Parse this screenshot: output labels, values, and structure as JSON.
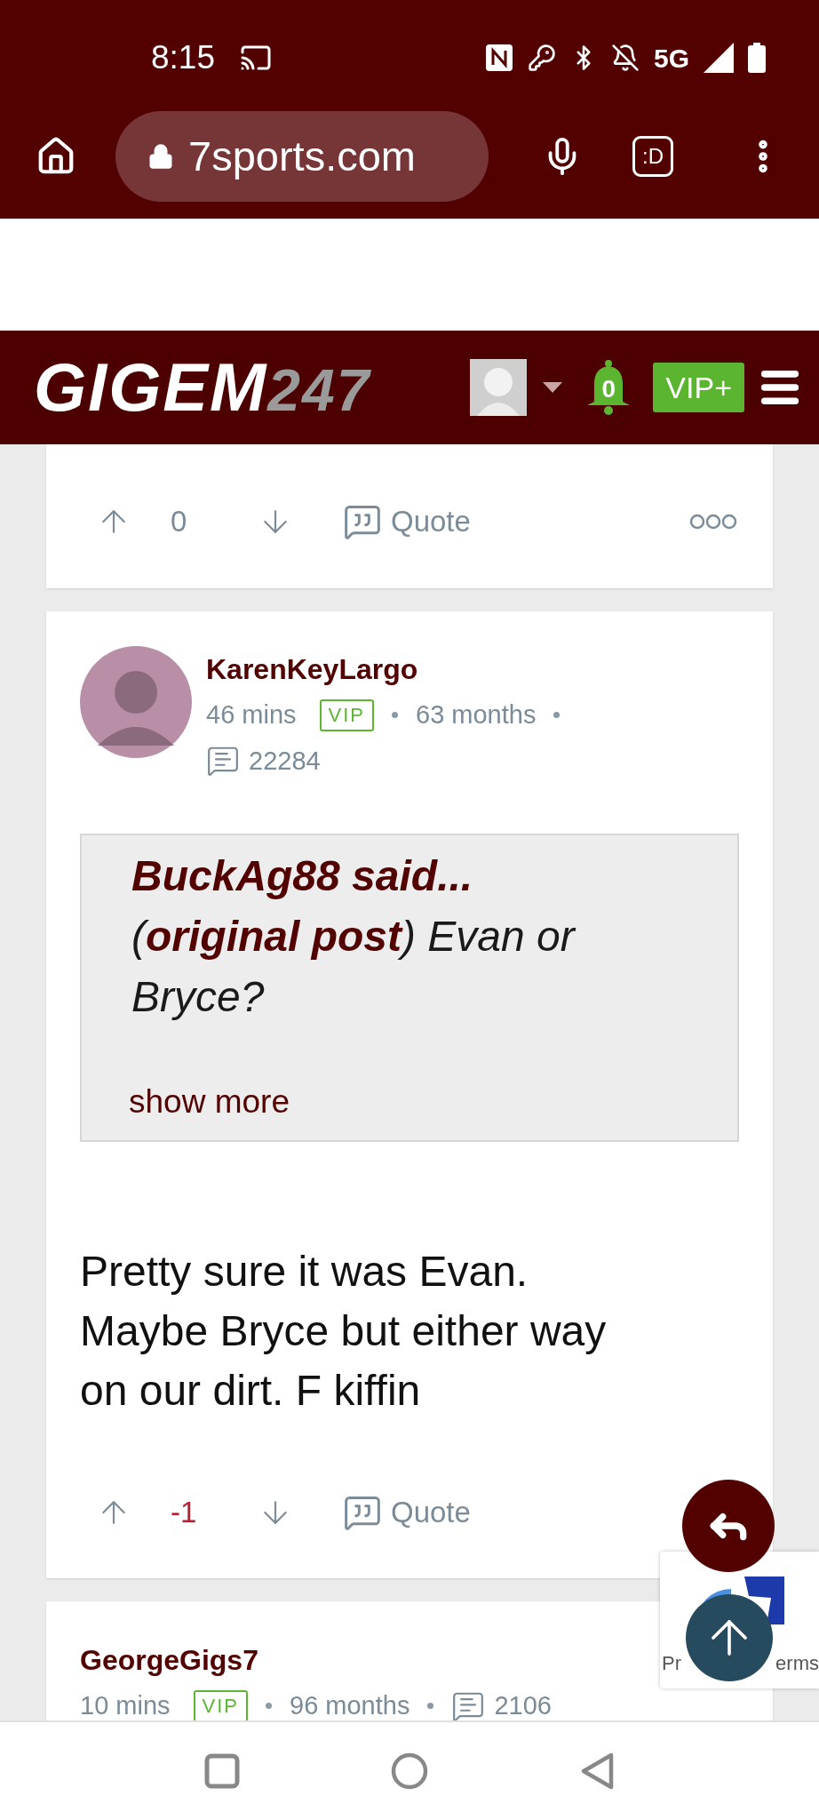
{
  "status_bar": {
    "time": "8:15",
    "network": "5G"
  },
  "browser": {
    "url": "7sports.com",
    "app_button": ":D"
  },
  "header": {
    "logo_main": "GIGEM",
    "logo_suffix": "247",
    "notifications": "0",
    "vip_button": "VIP+"
  },
  "posts": [
    {
      "actions": {
        "score": "0",
        "score_negative": false,
        "quote": "Quote",
        "more": true
      }
    },
    {
      "author": "KarenKeyLargo",
      "has_avatar": true,
      "time": "46 mins",
      "badge": "VIP",
      "tenure": "63 months",
      "post_count": "22284",
      "quote": {
        "heading": "BuckAg88 said...",
        "text": "(**original post**) Evan or Bryce?",
        "show_more": "show more"
      },
      "body": "Pretty sure it was Evan. Maybe Bryce but either way on our dirt. F kiffin",
      "actions": {
        "score": "-1",
        "score_negative": true,
        "quote": "Quote",
        "more": false
      }
    },
    {
      "author": "GeorgeGigs7",
      "has_avatar": false,
      "time": "10 mins",
      "badge": "VIP",
      "tenure": "96 months",
      "post_count": "2106"
    }
  ],
  "recaptcha": {
    "text_start": "Pr",
    "text_end": "erms"
  }
}
